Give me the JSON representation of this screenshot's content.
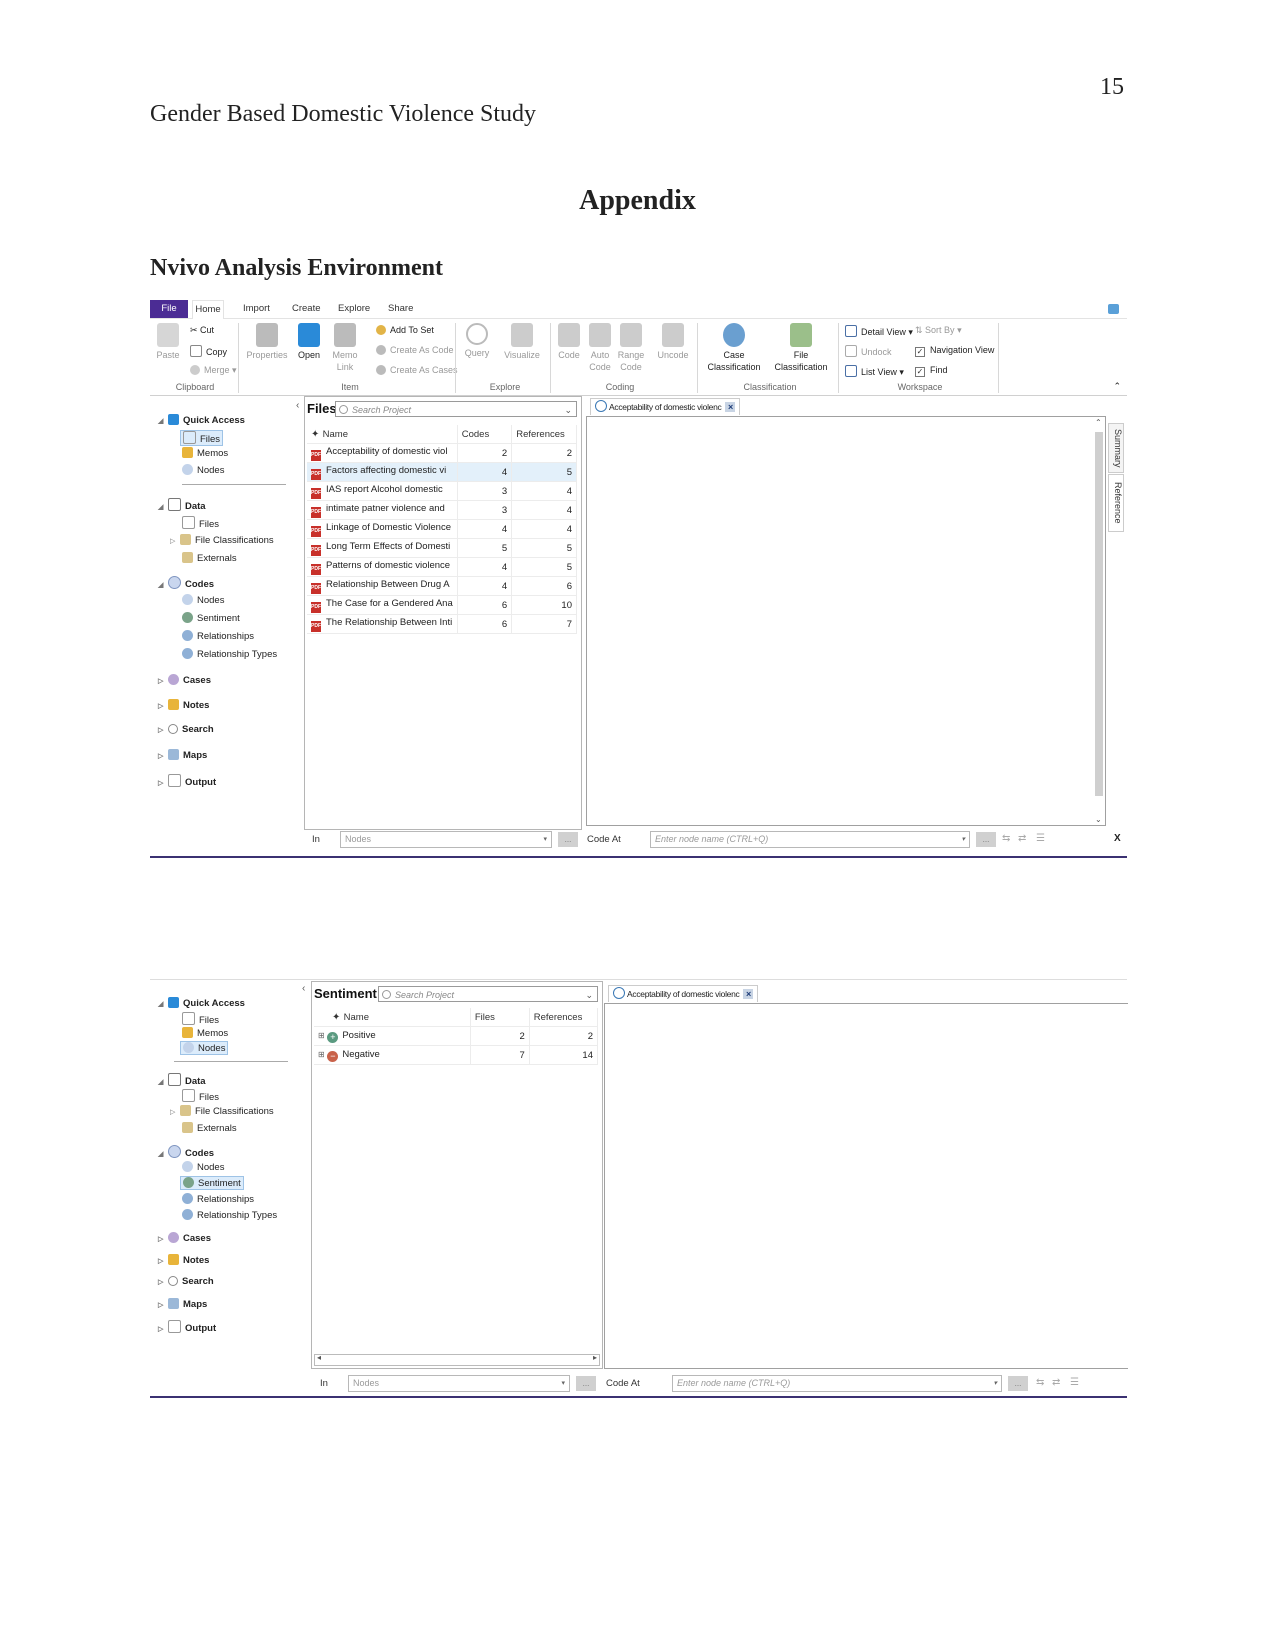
{
  "page": {
    "number": "15",
    "running_head": "Gender Based Domestic Violence Study",
    "heading": "Appendix",
    "section_heading": "Nvivo Analysis Environment"
  },
  "screenshot1": {
    "ribbon": {
      "tabs": [
        "File",
        "Home",
        "Import",
        "Create",
        "Explore",
        "Share"
      ],
      "active_tab": "Home",
      "clipboard": {
        "paste": "Paste",
        "cut": "Cut",
        "copy": "Copy",
        "merge": "Merge",
        "group": "Clipboard"
      },
      "item": {
        "properties": "Properties",
        "open": "Open",
        "memo_link": "Memo Link",
        "add_to_set": "Add To Set",
        "create_as_code": "Create As Code",
        "create_as_cases": "Create As Cases",
        "group": "Item"
      },
      "explore": {
        "query": "Query",
        "visualize": "Visualize",
        "group": "Explore"
      },
      "coding": {
        "code": "Code",
        "auto_code": "Auto Code",
        "range_code": "Range Code",
        "uncode": "Uncode",
        "group": "Coding"
      },
      "classification": {
        "case": "Case Classification",
        "file": "File Classification",
        "group": "Classification"
      },
      "workspace": {
        "detail_view": "Detail View",
        "sort_by": "Sort By",
        "undock": "Undock",
        "navigation_view": "Navigation View",
        "list_view": "List View",
        "find": "Find",
        "group": "Workspace"
      }
    },
    "nav": {
      "quick_access": "Quick Access",
      "quick_items": [
        "Files",
        "Memos",
        "Nodes"
      ],
      "selected": "Files",
      "data": "Data",
      "data_items": [
        "Files",
        "File Classifications",
        "Externals"
      ],
      "codes": "Codes",
      "codes_items": [
        "Nodes",
        "Sentiment",
        "Relationships",
        "Relationship Types"
      ],
      "others": [
        "Cases",
        "Notes",
        "Search",
        "Maps",
        "Output"
      ]
    },
    "list": {
      "title": "Files",
      "search_placeholder": "Search Project",
      "columns": [
        "Name",
        "Codes",
        "References"
      ],
      "rows": [
        {
          "name": "Acceptability of domestic viol",
          "codes": "2",
          "references": "2"
        },
        {
          "name": "Factors affecting domestic vi",
          "codes": "4",
          "references": "5"
        },
        {
          "name": "IAS report Alcohol domestic",
          "codes": "3",
          "references": "4"
        },
        {
          "name": "intimate patner violence and",
          "codes": "3",
          "references": "4"
        },
        {
          "name": "Linkage of Domestic Violence",
          "codes": "4",
          "references": "4"
        },
        {
          "name": "Long Term Effects of Domesti",
          "codes": "5",
          "references": "5"
        },
        {
          "name": "Patterns of domestic violence",
          "codes": "4",
          "references": "5"
        },
        {
          "name": "Relationship Between Drug A",
          "codes": "4",
          "references": "6"
        },
        {
          "name": "The Case for a Gendered Ana",
          "codes": "6",
          "references": "10"
        },
        {
          "name": "The Relationship Between Inti",
          "codes": "6",
          "references": "7"
        }
      ],
      "highlighted_row": 1
    },
    "detail": {
      "tab_label": "Acceptability of domestic violenc",
      "side_tabs": [
        "Summary",
        "Reference"
      ]
    },
    "bottom_bar": {
      "in_label": "In",
      "in_value": "Nodes",
      "dots": "...",
      "code_at_label": "Code At",
      "code_at_placeholder": "Enter node name (CTRL+Q)",
      "close": "X"
    }
  },
  "screenshot2": {
    "nav": {
      "quick_access": "Quick Access",
      "quick_items": [
        "Files",
        "Memos",
        "Nodes"
      ],
      "data": "Data",
      "data_items": [
        "Files",
        "File Classifications",
        "Externals"
      ],
      "codes": "Codes",
      "codes_items": [
        "Nodes",
        "Sentiment",
        "Relationships",
        "Relationship Types"
      ],
      "others": [
        "Cases",
        "Notes",
        "Search",
        "Maps",
        "Output"
      ]
    },
    "list": {
      "title": "Sentiment",
      "search_placeholder": "Search Project",
      "columns": [
        "Name",
        "Files",
        "References"
      ],
      "rows": [
        {
          "name": "Positive",
          "files": "2",
          "references": "2"
        },
        {
          "name": "Negative",
          "files": "7",
          "references": "14"
        }
      ]
    },
    "detail": {
      "tab_label": "Acceptability of domestic violenc"
    },
    "bottom_bar": {
      "in_label": "In",
      "in_value": "Nodes",
      "dots": "...",
      "code_at_label": "Code At",
      "code_at_placeholder": "Enter node name (CTRL+Q)"
    }
  },
  "colors": {
    "file_tab": "#4b2c94",
    "underline": "#3b3172",
    "highlight_row": "#e3f0fa",
    "pdf_icon": "#c8302a"
  }
}
